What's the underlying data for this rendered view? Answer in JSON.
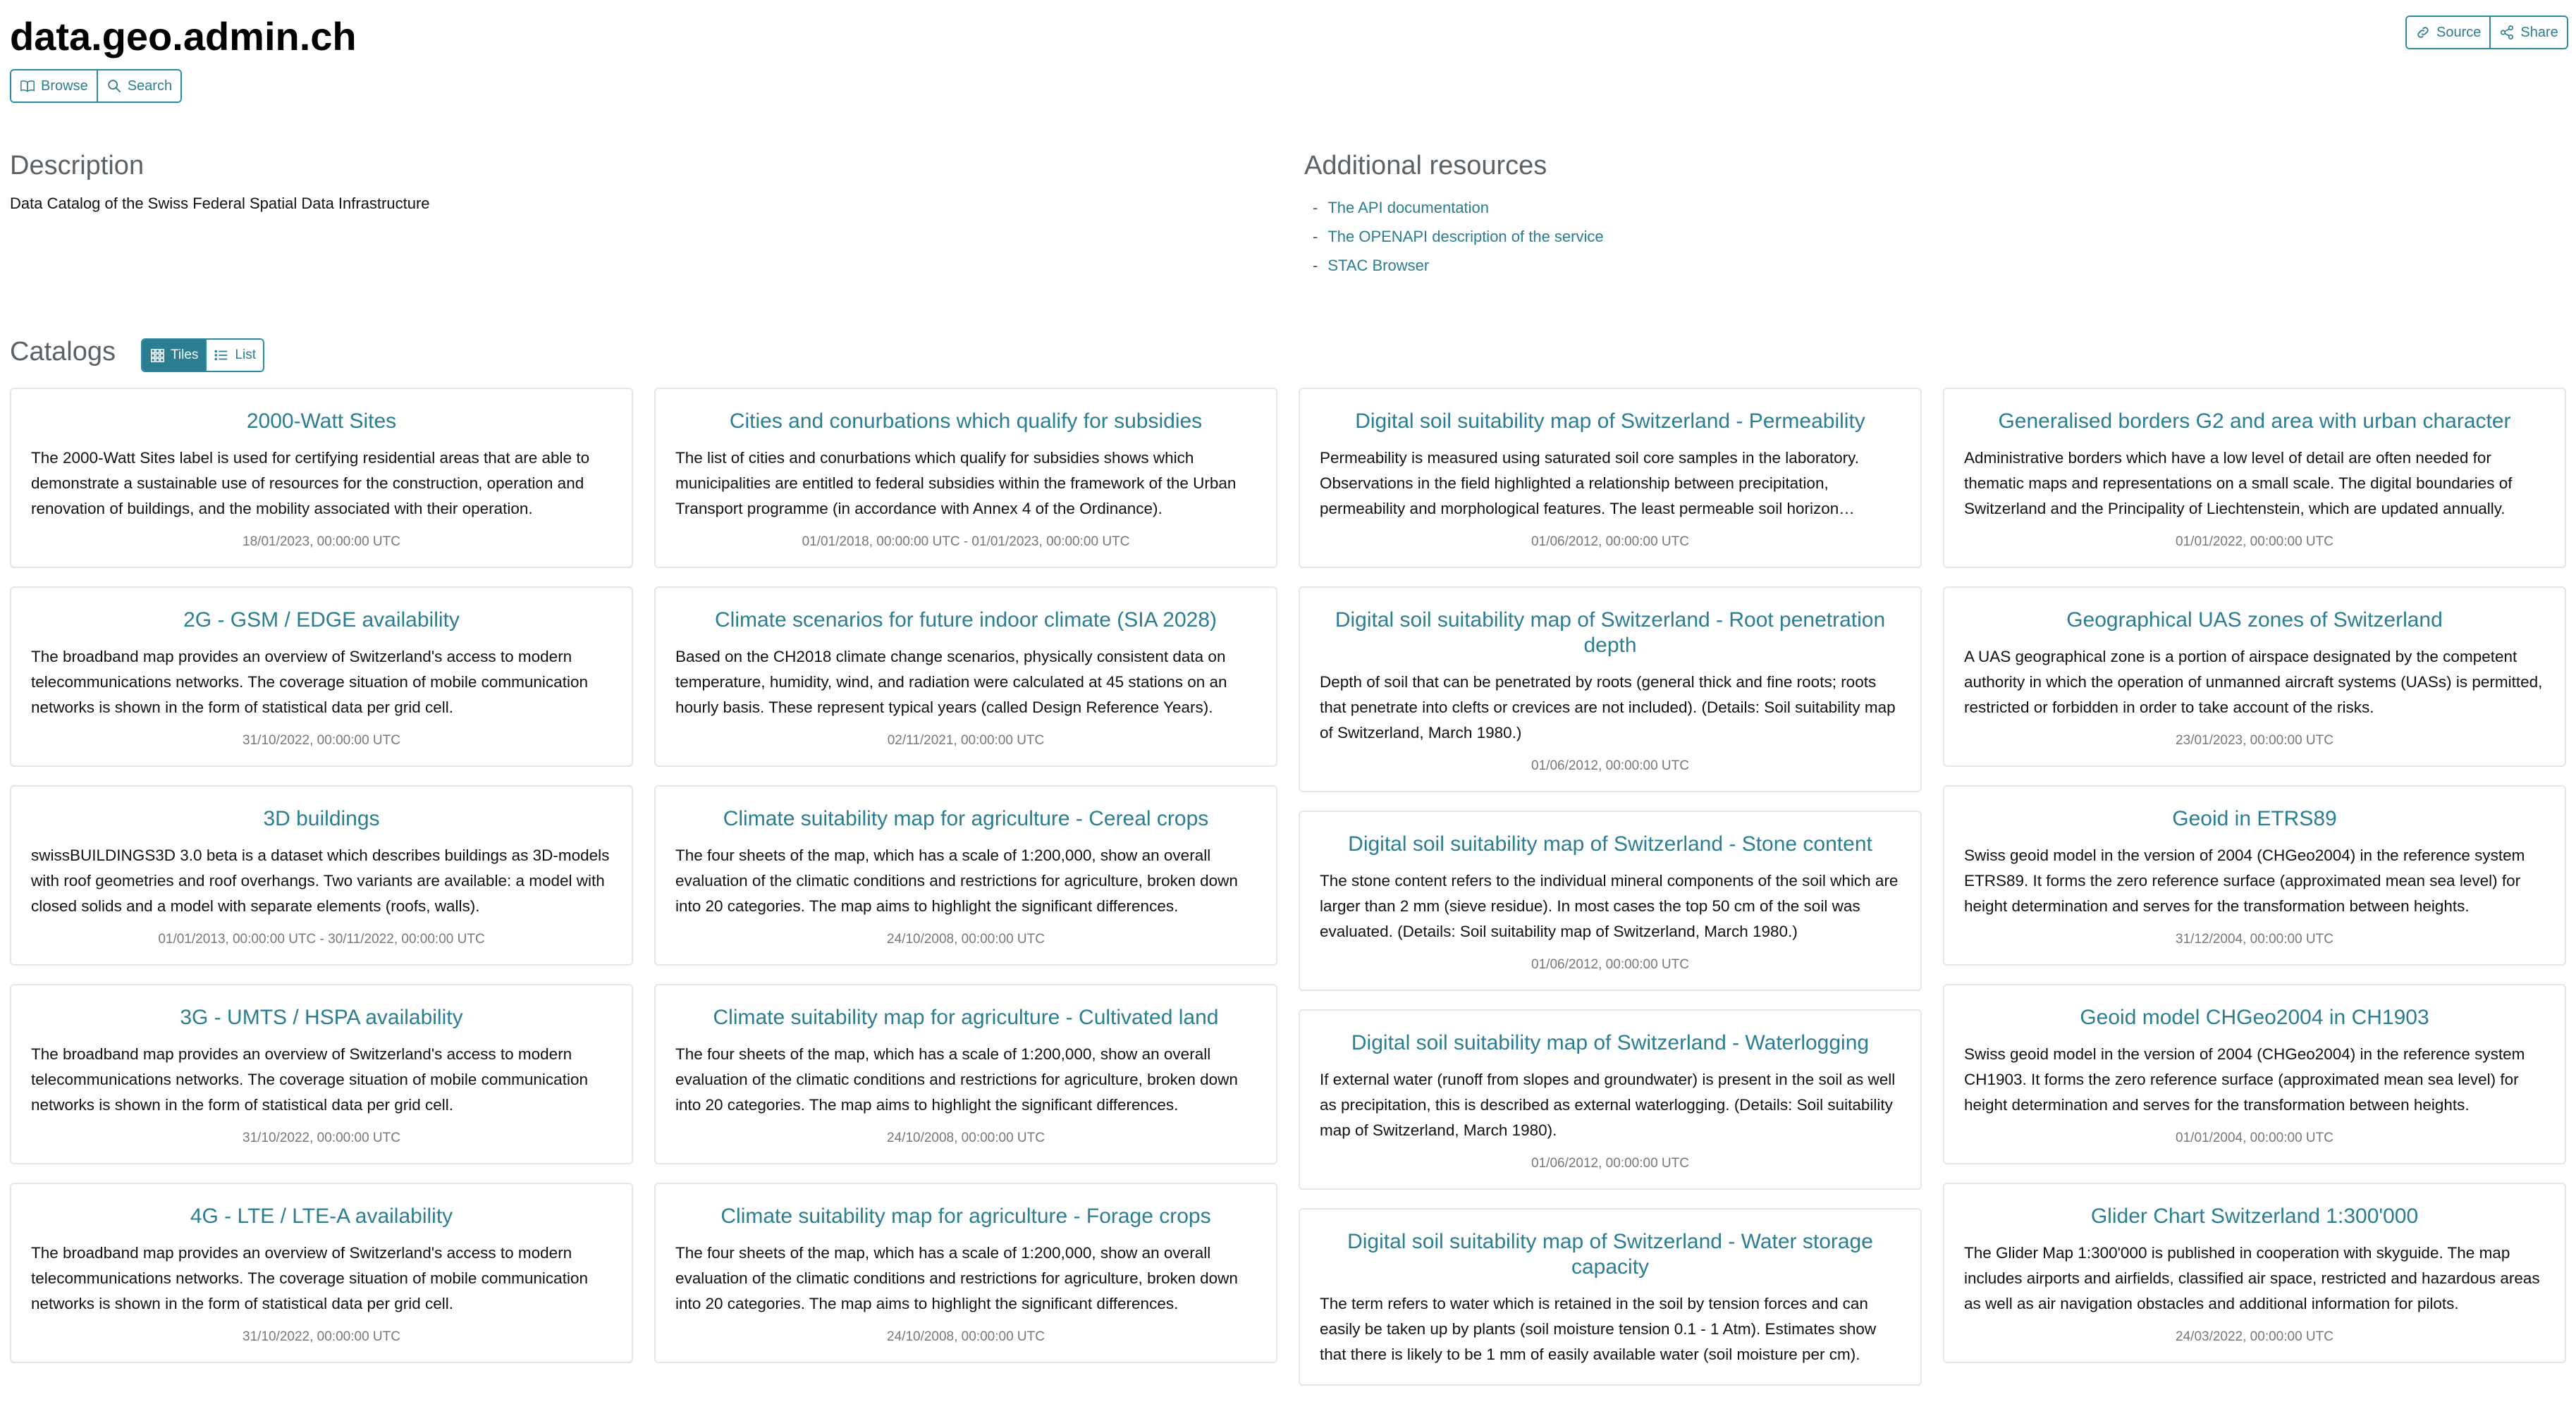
{
  "header": {
    "title": "data.geo.admin.ch",
    "browse_label": "Browse",
    "search_label": "Search",
    "source_label": "Source",
    "share_label": "Share"
  },
  "description": {
    "heading": "Description",
    "text": "Data Catalog of the Swiss Federal Spatial Data Infrastructure"
  },
  "resources": {
    "heading": "Additional resources",
    "links": [
      "The API documentation",
      "The OPENAPI description of the service",
      "STAC Browser"
    ]
  },
  "catalogs": {
    "heading": "Catalogs",
    "tiles_label": "Tiles",
    "list_label": "List",
    "columns": [
      [
        {
          "title": "2000-Watt Sites",
          "desc": "The 2000-Watt Sites label is used for certifying residential areas that are able to demonstrate a sustainable use of resources for the construction, operation and renovation of buildings, and the mobility associated with their operation.",
          "date": "18/01/2023, 00:00:00 UTC"
        },
        {
          "title": "2G - GSM / EDGE availability",
          "desc": "The broadband map provides an overview of Switzerland's access to modern telecommunications networks. The coverage situation of mobile communication networks is shown in the form of statistical data per grid cell.",
          "date": "31/10/2022, 00:00:00 UTC"
        },
        {
          "title": "3D buildings",
          "desc": "swissBUILDINGS3D 3.0 beta is a dataset which describes buildings as 3D-models with roof geometries and roof overhangs. Two variants are available: a model with closed solids and a model with separate elements (roofs, walls).",
          "date": "01/01/2013, 00:00:00 UTC - 30/11/2022, 00:00:00 UTC"
        },
        {
          "title": "3G - UMTS / HSPA availability",
          "desc": "The broadband map provides an overview of Switzerland's access to modern telecommunications networks. The coverage situation of mobile communication networks is shown in the form of statistical data per grid cell.",
          "date": "31/10/2022, 00:00:00 UTC"
        },
        {
          "title": "4G - LTE / LTE-A availability",
          "desc": "The broadband map provides an overview of Switzerland's access to modern telecommunications networks. The coverage situation of mobile communication networks is shown in the form of statistical data per grid cell.",
          "date": "31/10/2022, 00:00:00 UTC"
        }
      ],
      [
        {
          "title": "Cities and conurbations which qualify for subsidies",
          "desc": "The list of cities and conurbations which qualify for subsidies shows which municipalities are entitled to federal subsidies within the framework of the Urban Transport programme (in accordance with Annex 4 of the Ordinance).",
          "date": "01/01/2018, 00:00:00 UTC - 01/01/2023, 00:00:00 UTC"
        },
        {
          "title": "Climate scenarios for future indoor climate (SIA 2028)",
          "desc": "Based on the CH2018 climate change scenarios, physically consistent data on temperature, humidity, wind, and radiation were calculated at 45 stations on an hourly basis. These represent typical years (called Design Reference Years).",
          "date": "02/11/2021, 00:00:00 UTC"
        },
        {
          "title": "Climate suitability map for agriculture - Cereal crops",
          "desc": "The four sheets of the map, which has a scale of 1:200,000, show an overall evaluation of the climatic conditions and restrictions for agriculture, broken down into 20 categories. The map aims to highlight the significant differences.",
          "date": "24/10/2008, 00:00:00 UTC"
        },
        {
          "title": "Climate suitability map for agriculture - Cultivated land",
          "desc": "The four sheets of the map, which has a scale of 1:200,000, show an overall evaluation of the climatic conditions and restrictions for agriculture, broken down into 20 categories. The map aims to highlight the significant differences.",
          "date": "24/10/2008, 00:00:00 UTC"
        },
        {
          "title": "Climate suitability map for agriculture - Forage crops",
          "desc": "The four sheets of the map, which has a scale of 1:200,000, show an overall evaluation of the climatic conditions and restrictions for agriculture, broken down into 20 categories. The map aims to highlight the significant differences.",
          "date": "24/10/2008, 00:00:00 UTC"
        }
      ],
      [
        {
          "title": "Digital soil suitability map of Switzerland - Permeability",
          "desc": "Permeability is measured using saturated soil core samples in the laboratory. Observations in the field highlighted a relationship between precipitation, permeability and morphological features. The least permeable soil horizon determines the class.",
          "date": "01/06/2012, 00:00:00 UTC"
        },
        {
          "title": "Digital soil suitability map of Switzerland - Root penetration depth",
          "desc": "Depth of soil that can be penetrated by roots (general thick and fine roots; roots that penetrate into clefts or crevices are not included). (Details: Soil suitability map of Switzerland, March 1980.)",
          "date": "01/06/2012, 00:00:00 UTC"
        },
        {
          "title": "Digital soil suitability map of Switzerland - Stone content",
          "desc": "The stone content refers to the individual mineral components of the soil which are larger than 2 mm (sieve residue). In most cases the top 50 cm of the soil was evaluated. (Details: Soil suitability map of Switzerland, March 1980.)",
          "date": "01/06/2012, 00:00:00 UTC"
        },
        {
          "title": "Digital soil suitability map of Switzerland - Waterlogging",
          "desc": "If external water (runoff from slopes and groundwater) is present in the soil as well as precipitation, this is described as external waterlogging. (Details: Soil suitability map of Switzerland, March 1980).",
          "date": "01/06/2012, 00:00:00 UTC"
        },
        {
          "title": "Digital soil suitability map of Switzerland - Water storage capacity",
          "desc": "The term refers to water which is retained in the soil by tension forces and can easily be taken up by plants (soil moisture tension 0.1 - 1 Atm). Estimates show that there is likely to be 1 mm of easily available water (soil moisture per cm).",
          "date": ""
        }
      ],
      [
        {
          "title": "Generalised borders G2 and area with urban character",
          "desc": "Administrative borders which have a low level of detail are often needed for thematic maps and representations on a small scale. The digital boundaries of Switzerland and the Principality of Liechtenstein, which are updated annually.",
          "date": "01/01/2022, 00:00:00 UTC"
        },
        {
          "title": "Geographical UAS zones of Switzerland",
          "desc": "A UAS geographical zone is a portion of airspace designated by the competent authority in which the operation of unmanned aircraft systems (UASs) is permitted, restricted or forbidden in order to take account of the risks.",
          "date": "23/01/2023, 00:00:00 UTC"
        },
        {
          "title": "Geoid in ETRS89",
          "desc": "Swiss geoid model in the version of 2004 (CHGeo2004) in the reference system ETRS89. It forms the zero reference surface (approximated mean sea level) for height determination and serves for the transformation between heights.",
          "date": "31/12/2004, 00:00:00 UTC"
        },
        {
          "title": "Geoid model CHGeo2004 in CH1903",
          "desc": "Swiss geoid model in the version of 2004 (CHGeo2004) in the reference system CH1903. It forms the zero reference surface (approximated mean sea level) for height determination and serves for the transformation between heights.",
          "date": "01/01/2004, 00:00:00 UTC"
        },
        {
          "title": "Glider Chart Switzerland 1:300'000",
          "desc": "The Glider Map 1:300'000 is published in cooperation with skyguide. The map includes airports and airfields, classified air space, restricted and hazardous areas as well as air navigation obstacles and additional information for pilots.",
          "date": "24/03/2022, 00:00:00 UTC"
        }
      ]
    ]
  }
}
